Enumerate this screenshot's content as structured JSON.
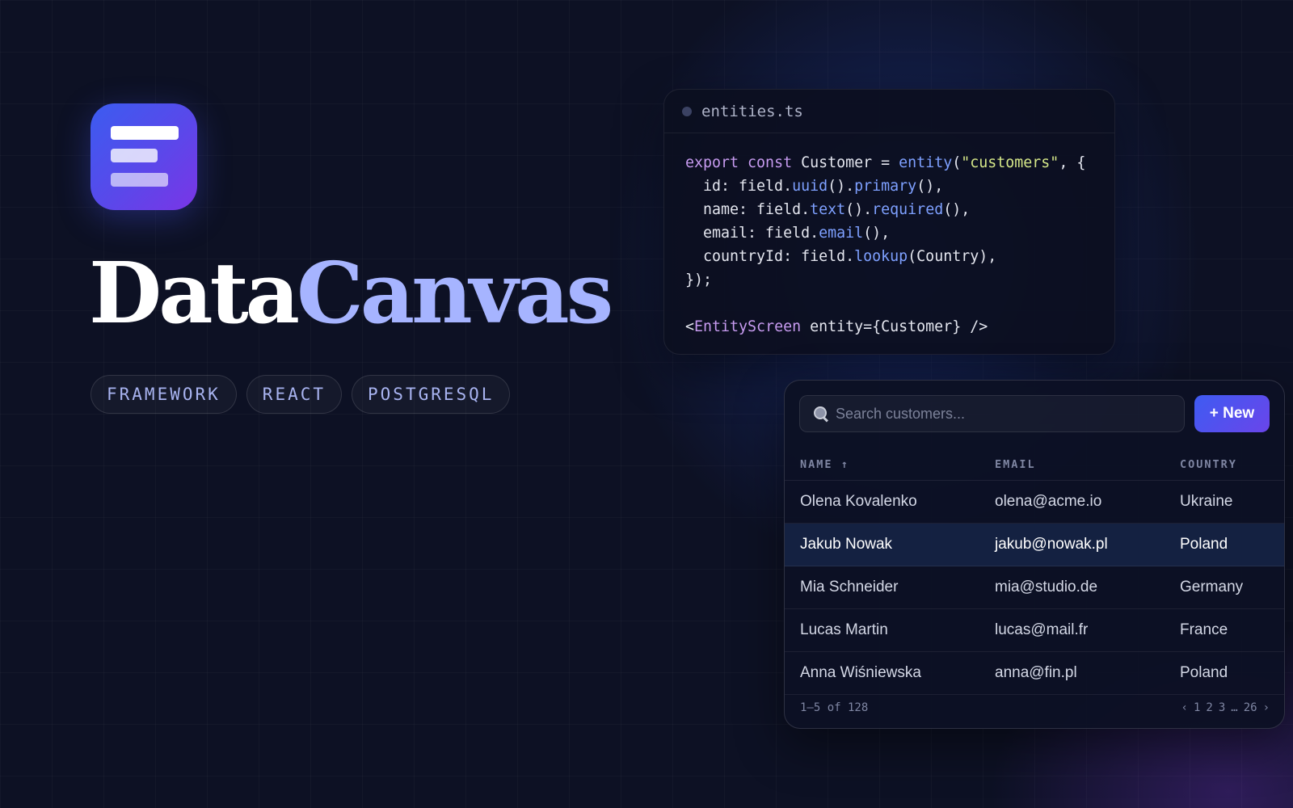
{
  "brand": {
    "title_part1": "Data",
    "title_part2": "Canvas",
    "tags": [
      "FRAMEWORK",
      "REACT",
      "POSTGRESQL"
    ],
    "icon": "stacked-bars-logo-icon",
    "colors": {
      "accent": "#a6b4ff",
      "logo_gradient_start": "#3b5cf0",
      "logo_gradient_end": "#7a35e6",
      "background": "#0d1124"
    }
  },
  "code_card": {
    "filename": "entities.ts",
    "icon": "dot-icon",
    "lines": [
      [
        [
          "kw",
          "export "
        ],
        [
          "kw",
          "const "
        ],
        [
          "",
          "Customer = "
        ],
        [
          "fn",
          "entity"
        ],
        [
          "",
          "("
        ],
        [
          "str",
          "\"customers\""
        ],
        [
          "",
          ", {"
        ]
      ],
      [
        [
          "",
          "  id: field."
        ],
        [
          "fn",
          "uuid"
        ],
        [
          "",
          "()."
        ],
        [
          "fn",
          "primary"
        ],
        [
          "",
          "(),"
        ]
      ],
      [
        [
          "",
          "  name: field."
        ],
        [
          "fn",
          "text"
        ],
        [
          "",
          "()."
        ],
        [
          "fn",
          "required"
        ],
        [
          "",
          "(),"
        ]
      ],
      [
        [
          "",
          "  email: field."
        ],
        [
          "fn",
          "email"
        ],
        [
          "",
          "(),"
        ]
      ],
      [
        [
          "",
          "  countryId: field."
        ],
        [
          "fn",
          "lookup"
        ],
        [
          "",
          "(Country),"
        ]
      ],
      [
        [
          "",
          "});"
        ]
      ],
      [
        [
          "",
          ""
        ]
      ],
      [
        [
          "",
          "<"
        ],
        [
          "tagc",
          "EntityScreen"
        ],
        [
          "",
          " entity={Customer} />"
        ]
      ]
    ]
  },
  "table_card": {
    "search": {
      "placeholder": "Search customers...",
      "value": "",
      "icon": "magnifier-icon"
    },
    "new_button_label": "+ New",
    "columns": {
      "name": "NAME ↑",
      "email": "EMAIL",
      "country": "COUNTRY"
    },
    "rows": [
      {
        "name": "Olena Kovalenko",
        "email": "olena@acme.io",
        "country": "Ukraine",
        "selected": false
      },
      {
        "name": "Jakub Nowak",
        "email": "jakub@nowak.pl",
        "country": "Poland",
        "selected": true
      },
      {
        "name": "Mia Schneider",
        "email": "mia@studio.de",
        "country": "Germany",
        "selected": false
      },
      {
        "name": "Lucas Martin",
        "email": "lucas@mail.fr",
        "country": "France",
        "selected": false
      },
      {
        "name": "Anna Wiśniewska",
        "email": "anna@fin.pl",
        "country": "Poland",
        "selected": false
      }
    ],
    "footer": {
      "range": "1–5 of 128",
      "pager": {
        "prev": "‹",
        "pages": [
          "1",
          "2",
          "3"
        ],
        "ellipsis": "…",
        "last": "26",
        "next": "›"
      }
    }
  }
}
